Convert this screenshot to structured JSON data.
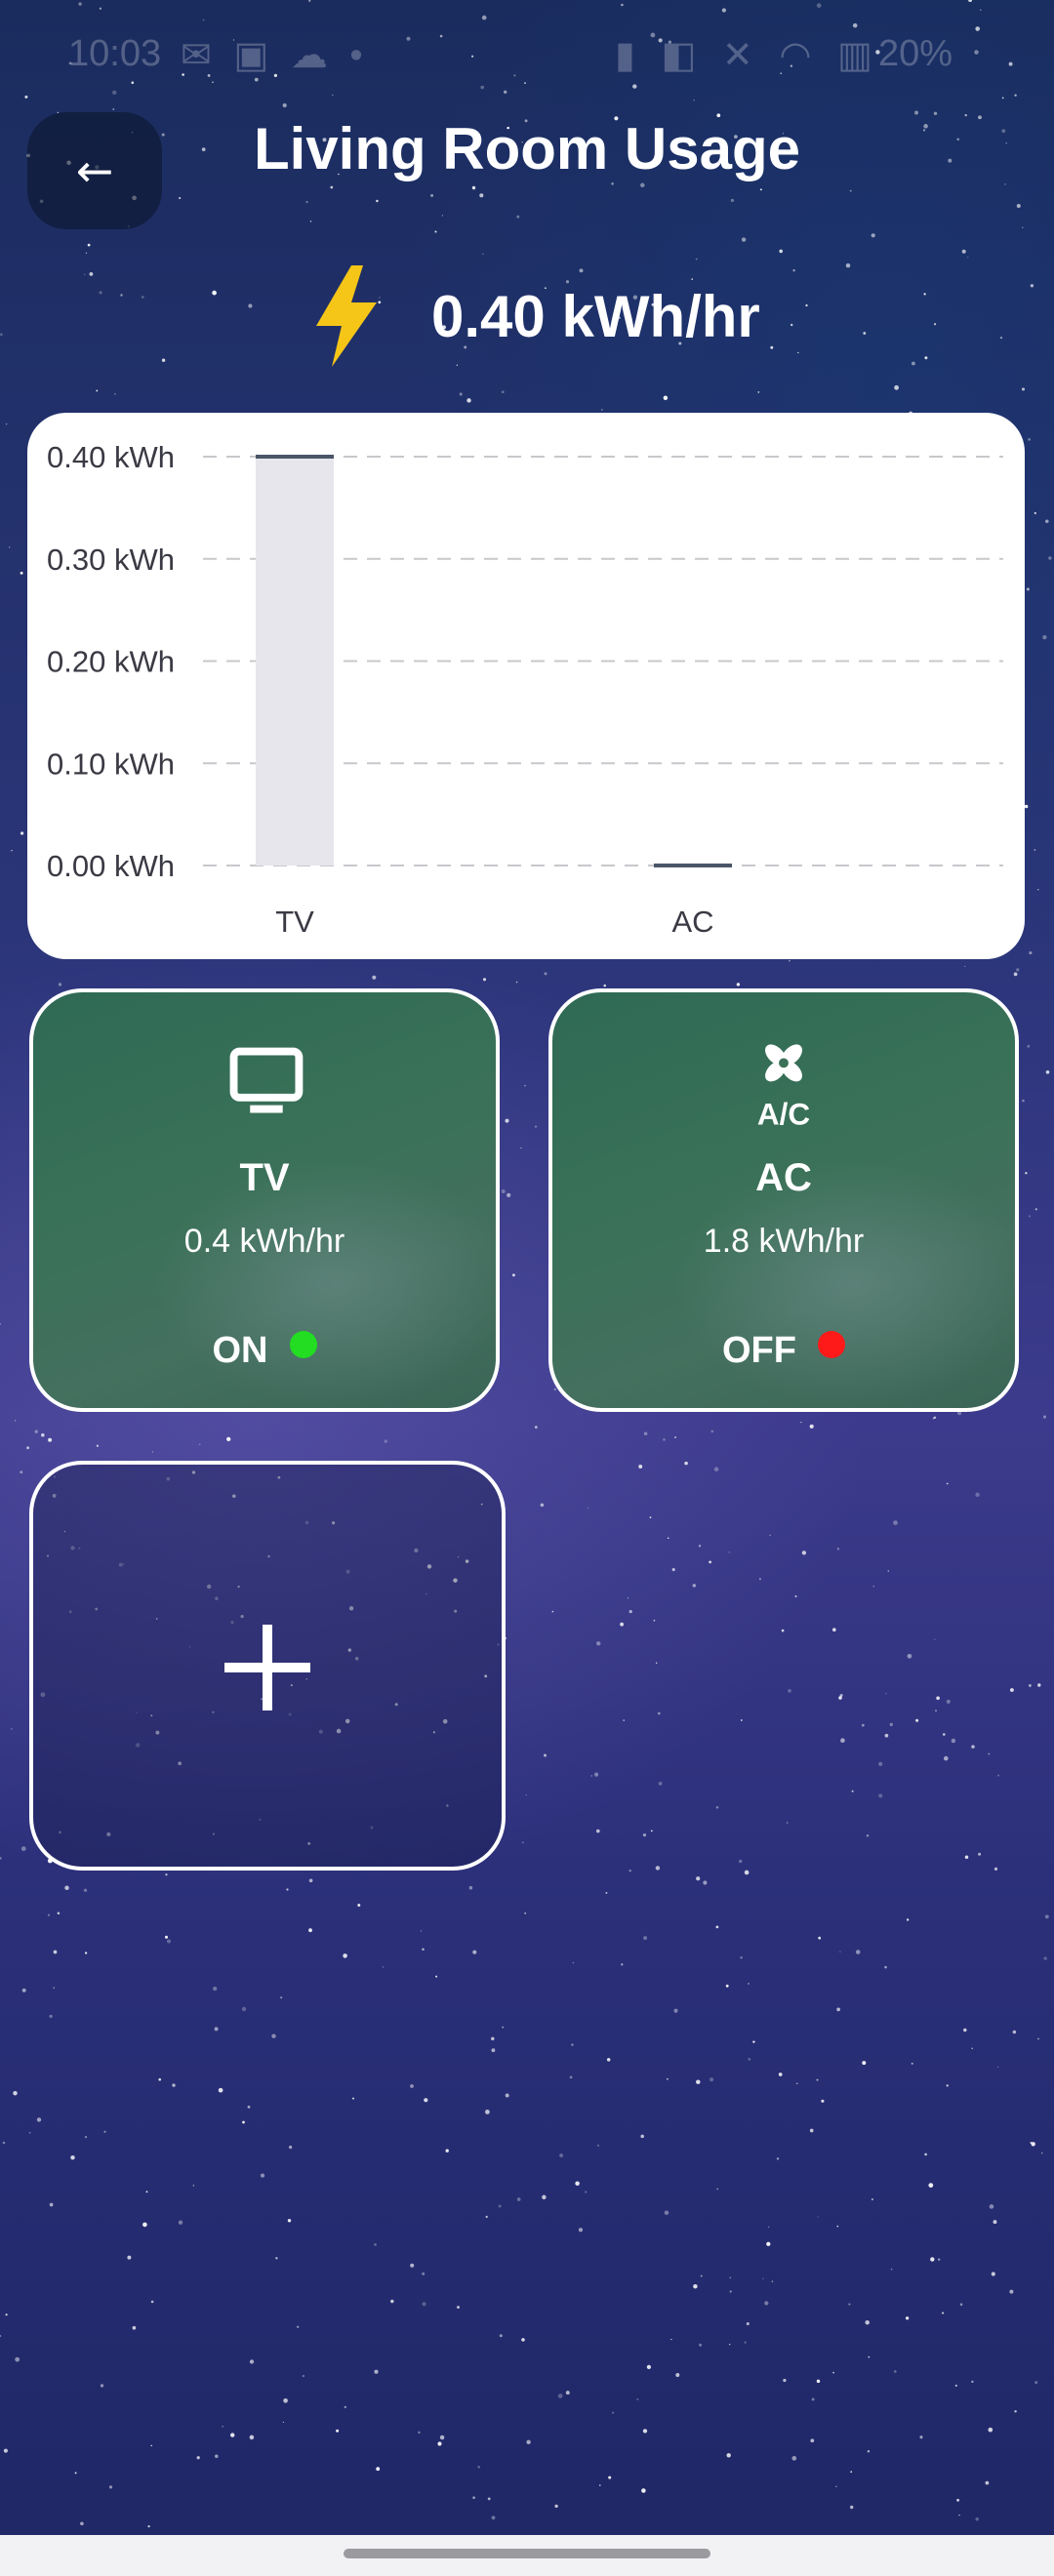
{
  "status_bar": {
    "time": "10:03",
    "left_icons": "✉ ▣ ☁ •",
    "right_icons": "▮ ◧ ✕ ◠ ▥",
    "battery": "20%"
  },
  "header": {
    "title": "Living Room Usage",
    "back_icon": "left-arrow-icon"
  },
  "usage": {
    "icon": "lightning-bolt-icon",
    "icon_color": "#f5c518",
    "value": "0.40 kWh/hr"
  },
  "chart_data": {
    "type": "bar",
    "categories": [
      "TV",
      "AC"
    ],
    "values": [
      0.4,
      0.0
    ],
    "y_ticks": [
      "0.00 kWh",
      "0.10 kWh",
      "0.20 kWh",
      "0.30 kWh",
      "0.40 kWh"
    ],
    "y_tick_values": [
      0,
      0.1,
      0.2,
      0.3,
      0.4
    ],
    "ylim": [
      0,
      0.4
    ],
    "grid": true,
    "bar_color": "#e6e6ec",
    "bar_edge_color": "#4a5568",
    "title": "",
    "xlabel": "",
    "ylabel": ""
  },
  "devices": [
    {
      "name": "TV",
      "icon": "tv-icon",
      "rate": "0.4 kWh/hr",
      "status": "ON",
      "status_color": "#22dd22"
    },
    {
      "name": "AC",
      "icon": "fan-ac-icon",
      "rate": "1.8 kWh/hr",
      "status": "OFF",
      "status_color": "#ff1a1a"
    }
  ],
  "add_device": {
    "icon": "plus-icon"
  }
}
